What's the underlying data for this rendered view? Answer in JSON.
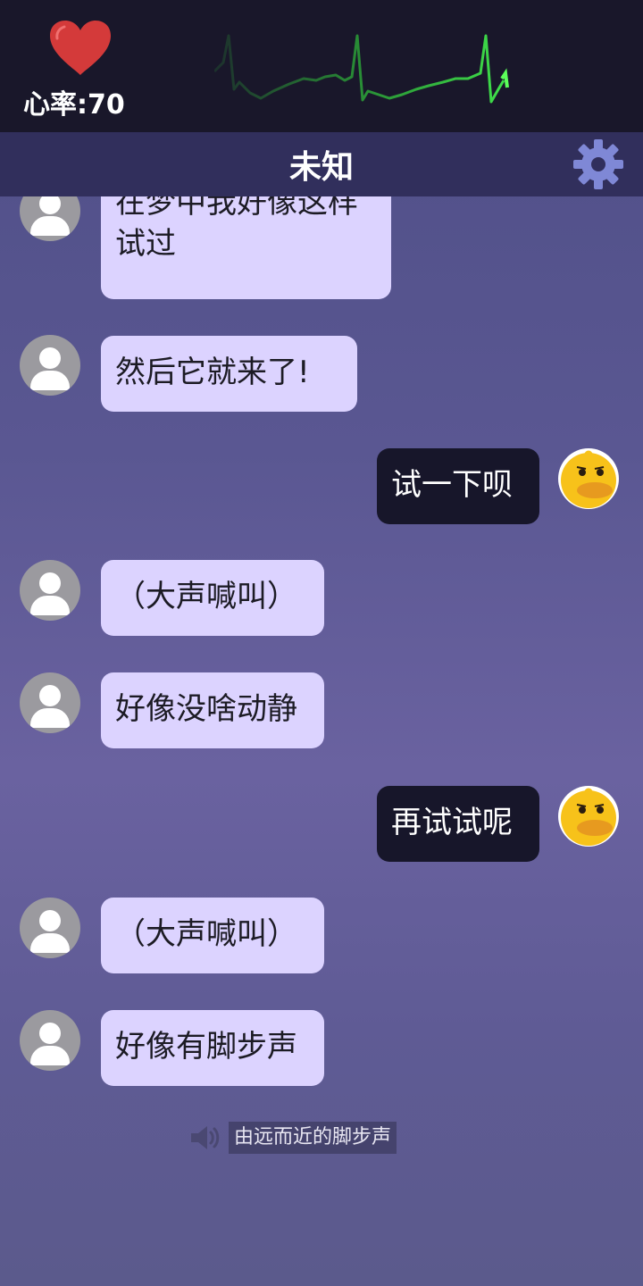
{
  "hud": {
    "heart_rate_label": "心率:70",
    "heart_icon": "heart-icon",
    "ecg_icon": "ecg-line"
  },
  "header": {
    "title": "未知",
    "settings_icon": "gear-icon"
  },
  "messages": [
    {
      "side": "npc",
      "text_lines": [
        "在梦中我好像这样",
        "试过"
      ]
    },
    {
      "side": "npc",
      "text": "然后它就来了!"
    },
    {
      "side": "me",
      "text": "试一下呗"
    },
    {
      "side": "npc",
      "text": "（大声喊叫）"
    },
    {
      "side": "npc",
      "text": "好像没啥动静"
    },
    {
      "side": "me",
      "text": "再试试呢"
    },
    {
      "side": "npc",
      "text": "（大声喊叫）"
    },
    {
      "side": "npc",
      "text": "好像有脚步声"
    }
  ],
  "sound_effect": {
    "icon": "speaker-icon",
    "text": "由远而近的脚步声"
  },
  "colors": {
    "hud_bg": "#19172a",
    "titlebar_bg": "#312f5c",
    "npc_bubble": "#dcd3ff",
    "player_bubble": "#17162a",
    "heart": "#d43a3a",
    "ecg": "#2fbf3a"
  }
}
